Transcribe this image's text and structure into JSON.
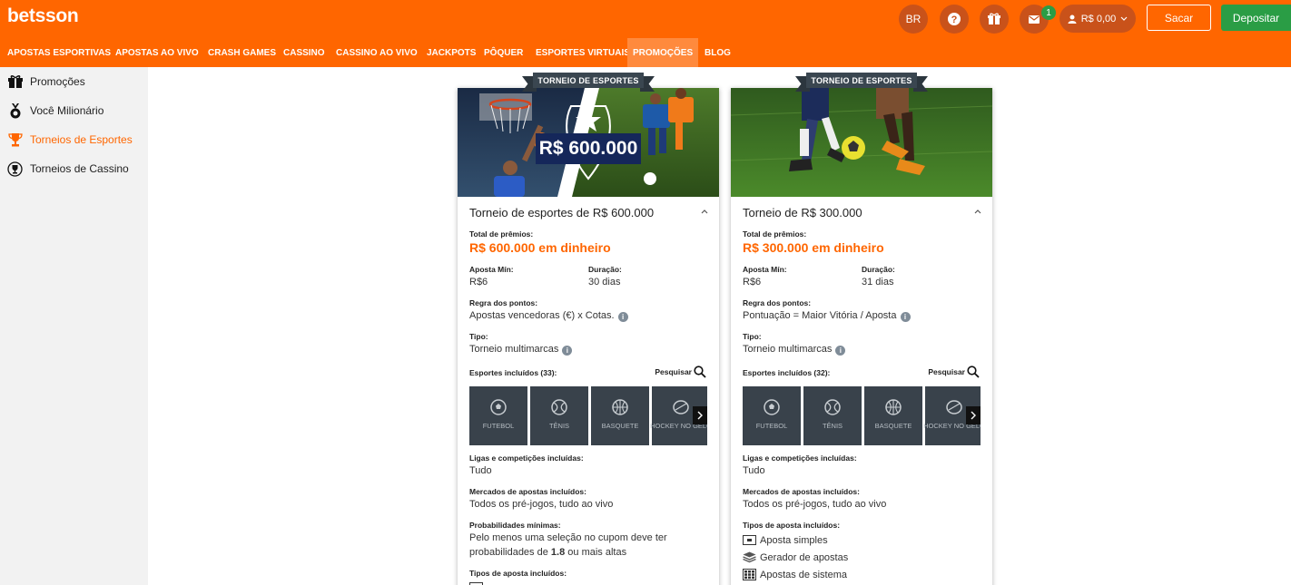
{
  "header": {
    "logo": "betsson",
    "lang": "BR",
    "notification_count": "1",
    "balance": "R$ 0,00",
    "withdraw_label": "Sacar",
    "deposit_label": "Depositar"
  },
  "nav": {
    "items": [
      "APOSTAS ESPORTIVAS",
      "APOSTAS AO VIVO",
      "CRASH GAMES",
      "CASSINO",
      "CASSINO AO VIVO",
      "JACKPOTS",
      "PÔQUER",
      "ESPORTES VIRTUAIS",
      "PROMOÇÕES",
      "BLOG"
    ],
    "active": "PROMOÇÕES"
  },
  "sidebar": {
    "items": [
      {
        "label": "Promoções",
        "icon": "gift-icon"
      },
      {
        "label": "Você Milionário",
        "icon": "medal-icon"
      },
      {
        "label": "Torneios de Esportes",
        "icon": "trophy-icon",
        "active": true
      },
      {
        "label": "Torneios de Cassino",
        "icon": "casino-trophy-icon"
      }
    ]
  },
  "cards": [
    {
      "ribbon": "TORNEIO DE ESPORTES",
      "hero_amount": "R$ 600.000",
      "title": "Torneio de esportes de R$ 600.000",
      "total_label": "Total de prêmios:",
      "total_value": "R$ 600.000 em dinheiro",
      "min_bet_label": "Aposta Mín:",
      "min_bet_value": "R$6",
      "duration_label": "Duração:",
      "duration_value": "30 dias",
      "points_label": "Regra dos pontos:",
      "points_value": "Apostas vencedoras (€) x Cotas.",
      "type_label": "Tipo:",
      "type_value": "Torneio multimarcas",
      "sports_label": "Esportes incluídos (33):",
      "search_label": "Pesquisar",
      "sports": [
        "FUTEBOL",
        "TÊNIS",
        "BASQUETE",
        "HOCKEY NO GELO"
      ],
      "leagues_label": "Ligas e competições incluídas:",
      "leagues_value": "Tudo",
      "markets_label": "Mercados de apostas incluídos:",
      "markets_value": "Todos os pré-jogos, tudo ao vivo",
      "odds_label": "Probabilidades mínimas:",
      "odds_line1": "Pelo menos uma seleção no cupom deve ter",
      "odds_line2_pre": "probabilidades de",
      "odds_value": "1.8",
      "odds_line2_post": "ou mais altas",
      "bet_types_label": "Tipos de aposta incluídos:"
    },
    {
      "ribbon": "TORNEIO DE ESPORTES",
      "title": "Torneio de R$ 300.000",
      "total_label": "Total de prêmios:",
      "total_value": "R$ 300.000 em dinheiro",
      "min_bet_label": "Aposta Mín:",
      "min_bet_value": "R$6",
      "duration_label": "Duração:",
      "duration_value": "31 dias",
      "points_label": "Regra dos pontos:",
      "points_value": "Pontuação = Maior Vitória / Aposta",
      "type_label": "Tipo:",
      "type_value": "Torneio multimarcas",
      "sports_label": "Esportes incluídos (32):",
      "search_label": "Pesquisar",
      "sports": [
        "FUTEBOL",
        "TÊNIS",
        "BASQUETE",
        "HOCKEY NO GELO"
      ],
      "leagues_label": "Ligas e competições incluídas:",
      "leagues_value": "Tudo",
      "markets_label": "Mercados de apostas incluídos:",
      "markets_value": "Todos os pré-jogos, tudo ao vivo",
      "bet_types_label": "Tipos de aposta incluídos:",
      "bet_types": [
        "Aposta simples",
        "Gerador de apostas",
        "Apostas de sistema"
      ]
    }
  ]
}
